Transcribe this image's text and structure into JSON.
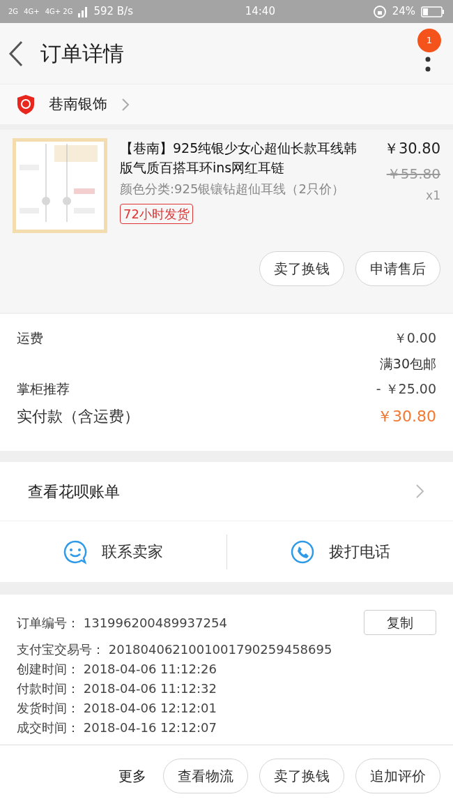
{
  "status_bar": {
    "networks": [
      "2G",
      "4G+",
      "4G+ 2G"
    ],
    "speed": "592 B/s",
    "time": "14:40",
    "battery": "24%"
  },
  "header": {
    "title": "订单详情",
    "badge": "1"
  },
  "shop": {
    "name": "巷南银饰"
  },
  "product": {
    "image": {
      "kind": "picture"
    },
    "title": "【巷南】925纯银少女心超仙长款耳线韩版气质百搭耳环ins网红耳链",
    "variant": "颜色分类:925银镶钻超仙耳线（2只价）",
    "tag": "72小时发货",
    "price": "￥30.80",
    "original_price": "￥55.80",
    "quantity": "x1",
    "actions": [
      "卖了换钱",
      "申请售后"
    ]
  },
  "costs": [
    {
      "label": "运费",
      "value": "￥0.00",
      "note": "满30包邮",
      "kind": "normal"
    },
    {
      "label": "掌柜推荐",
      "value": "- ￥25.00",
      "kind": "normal"
    },
    {
      "label": "实付款（含运费）",
      "value": "￥30.80",
      "kind": "total"
    }
  ],
  "huabei": {
    "label": "查看花呗账单"
  },
  "contact": [
    {
      "label": "联系卖家",
      "kind": "chat"
    },
    {
      "label": "拨打电话",
      "kind": "phone"
    }
  ],
  "order_info": {
    "copy_button": "复制",
    "fields": [
      {
        "label": "订单编号：",
        "value": "131996200489937254"
      },
      {
        "label": "支付宝交易号：",
        "value": "2018040621001001790259458695"
      },
      {
        "label": "创建时间：",
        "value": "2018-04-06 11:12:26"
      },
      {
        "label": "付款时间：",
        "value": "2018-04-06 11:12:32"
      },
      {
        "label": "发货时间：",
        "value": "2018-04-06 12:12:01"
      },
      {
        "label": "成交时间：",
        "value": "2018-04-16 12:12:07"
      }
    ]
  },
  "bottom_bar": {
    "more": "更多",
    "buttons": [
      "查看物流",
      "卖了换钱",
      "追加评价"
    ]
  }
}
